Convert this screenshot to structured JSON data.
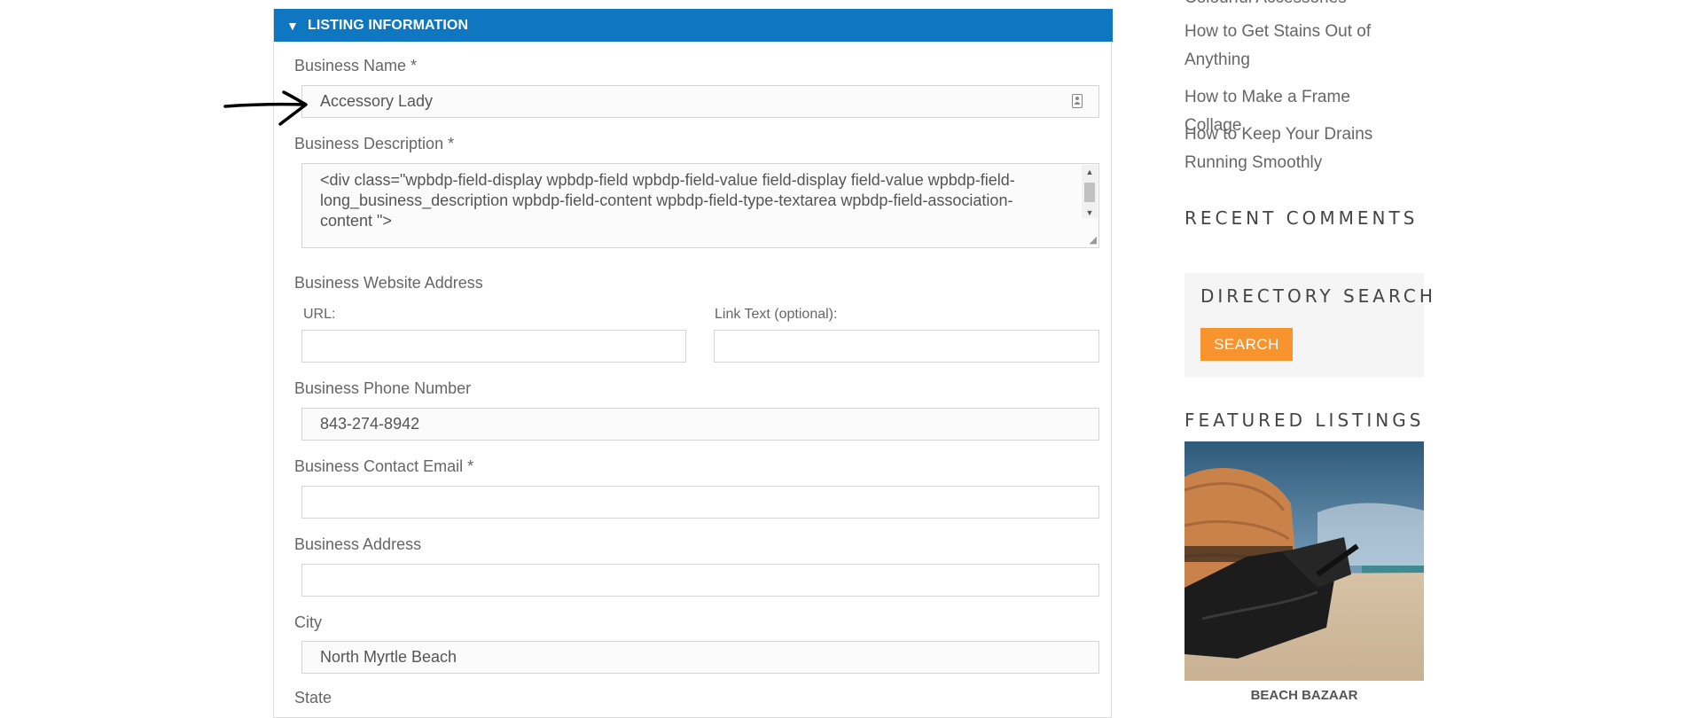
{
  "form": {
    "section_title": "LISTING INFORMATION",
    "business_name": {
      "label": "Business Name *",
      "value": "Accessory Lady"
    },
    "business_description": {
      "label": "Business Description *",
      "value": "<div class=\"wpbdp-field-display wpbdp-field wpbdp-field-value field-display field-value wpbdp-field-long_business_description wpbdp-field-content wpbdp-field-type-textarea wpbdp-field-association-content \">"
    },
    "website": {
      "label": "Business Website Address",
      "url_label": "URL:",
      "url_value": "",
      "link_text_label": "Link Text (optional):",
      "link_text_value": ""
    },
    "phone": {
      "label": "Business Phone Number",
      "value": "843-274-8942"
    },
    "email": {
      "label": "Business Contact Email *",
      "value": ""
    },
    "address": {
      "label": "Business Address",
      "value": ""
    },
    "city": {
      "label": "City",
      "value": "North Myrtle Beach"
    },
    "state": {
      "label": "State"
    }
  },
  "sidebar": {
    "top_partial_link": "Colourful Accessories",
    "links": [
      "How to Get Stains Out of Anything",
      "How to Make a Frame Collage",
      "How to Keep Your Drains Running Smoothly"
    ],
    "recent_comments_title": "RECENT COMMENTS",
    "directory_search_title": "DIRECTORY SEARCH",
    "search_button": "SEARCH",
    "featured_title": "FEATURED LISTINGS",
    "featured_caption": "BEACH BAZAAR"
  },
  "colors": {
    "header_blue": "#0f76c1",
    "search_orange": "#f7942d"
  }
}
